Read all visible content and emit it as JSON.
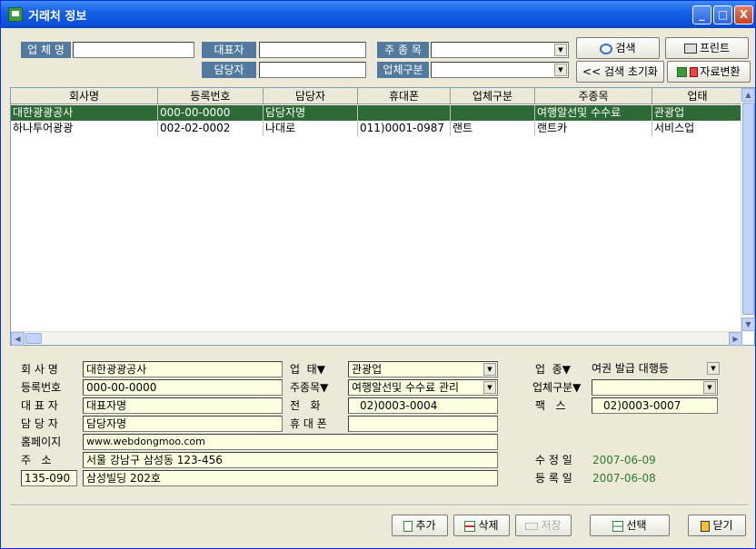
{
  "window": {
    "title": "거래처 정보",
    "min": "_",
    "max": "□",
    "close": "X"
  },
  "search": {
    "company_label": "업 체 명",
    "company_value": "",
    "rep_label": "대표자",
    "rep_value": "",
    "manager_label": "담당자",
    "manager_value": "",
    "main_item_label": "주 종 목",
    "main_item_value": "",
    "type_label": "업체구분",
    "type_value": "",
    "search_btn": "검색",
    "print_btn": "프린트",
    "reset_btn": "<< 검색 초기화",
    "convert_btn": "자료변환"
  },
  "grid": {
    "headers": [
      "회사명",
      "등록번호",
      "담당자",
      "휴대폰",
      "업체구분",
      "주종목",
      "업태"
    ],
    "rows": [
      [
        "대한광광공사",
        "000-00-0000",
        "담당자명",
        "",
        "",
        "여행알선및 수수료",
        "관광업"
      ],
      [
        "하나투어광광",
        "002-02-0002",
        "나대로",
        "011)0001-0987",
        "랜트",
        "랜트카",
        "서비스업"
      ]
    ]
  },
  "detail": {
    "company_label": "회 사 명",
    "company_value": "대한광광공사",
    "reg_label": "등록번호",
    "reg_value": "000-00-0000",
    "rep_label": "대 표 자",
    "rep_value": "대표자명",
    "manager_label": "담 당 자",
    "manager_value": "담당자명",
    "homepage_label": "홈페이지",
    "homepage_value": "www.webdongmoo.com",
    "address_label": "주   소",
    "address_value": "서울 강남구 삼성동 123-456",
    "zip_value": "135-090",
    "address2_value": "삼성빌딩 202호",
    "biz_label": "업  태▼",
    "biz_value": "관광업",
    "item_label": "주종목▼",
    "item_value": "여행알선및 수수료 관리",
    "phone_label": "전   화",
    "phone_value": "02)0003-0004",
    "mobile_label": "휴 대 폰",
    "mobile_value": "",
    "kind_label": "업  종▼",
    "kind_value": "여권 발급 대행등",
    "type_label": "업체구분▼",
    "type_value": "",
    "fax_label": "팩   스",
    "fax_value": "02)0003-0007",
    "modified_label": "수 정 일",
    "modified_value": "2007-06-09",
    "registered_label": "등 록 일",
    "registered_value": "2007-06-08"
  },
  "actions": {
    "add": "추가",
    "delete": "삭제",
    "save": "저장",
    "select": "선택",
    "close": "닫기"
  },
  "colors": {
    "selected_row": "#2d6a35",
    "label_bg": "#527a9e",
    "yellow_field": "#ffffe1"
  }
}
